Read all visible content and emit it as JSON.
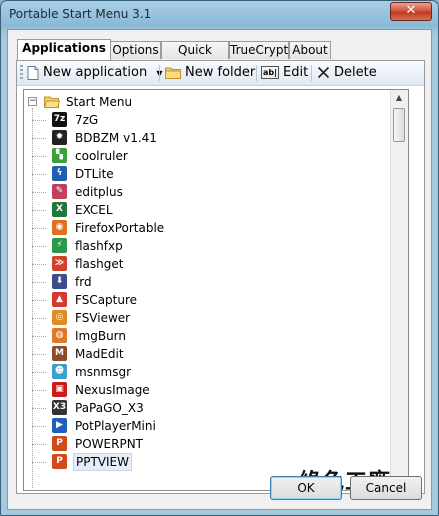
{
  "window": {
    "title": "Portable Start Menu 3.1",
    "close_glyph": "✕"
  },
  "tabs": [
    {
      "label": "Applications",
      "active": true
    },
    {
      "label": "Options",
      "active": false
    },
    {
      "label": "Quick Start",
      "active": false
    },
    {
      "label": "TrueCrypt",
      "active": false
    },
    {
      "label": "About",
      "active": false
    }
  ],
  "toolbar": {
    "new_application": "New application",
    "new_folder": "New folder",
    "edit": "Edit",
    "delete": "Delete",
    "edit_icon_text": "ab|"
  },
  "tree": {
    "root": "Start Menu",
    "items": [
      {
        "label": "7zG",
        "icon": "7z-icon",
        "color": "#111111",
        "glyph": "7z"
      },
      {
        "label": "BDBZM v1.41",
        "icon": "bdbzm-icon",
        "color": "#222222",
        "glyph": "✹"
      },
      {
        "label": "coolruler",
        "icon": "ruler-icon",
        "color": "#3aa03a",
        "glyph": "▚"
      },
      {
        "label": "DTLite",
        "icon": "daemon-tools-icon",
        "color": "#1f5fb0",
        "glyph": "ϟ"
      },
      {
        "label": "editplus",
        "icon": "editplus-icon",
        "color": "#c04060",
        "glyph": "✎"
      },
      {
        "label": "EXCEL",
        "icon": "excel-icon",
        "color": "#1f7a3a",
        "glyph": "X"
      },
      {
        "label": "FirefoxPortable",
        "icon": "firefox-icon",
        "color": "#e0701c",
        "glyph": "◉"
      },
      {
        "label": "flashfxp",
        "icon": "flashfxp-icon",
        "color": "#2a9a4a",
        "glyph": "⚡"
      },
      {
        "label": "flashget",
        "icon": "flashget-icon",
        "color": "#d0402a",
        "glyph": "≫"
      },
      {
        "label": "frd",
        "icon": "download-icon",
        "color": "#3b4d8a",
        "glyph": "⬇"
      },
      {
        "label": "FSCapture",
        "icon": "fscapture-icon",
        "color": "#d23a30",
        "glyph": "▲"
      },
      {
        "label": "FSViewer",
        "icon": "fsviewer-icon",
        "color": "#e08a20",
        "glyph": "◎"
      },
      {
        "label": "ImgBurn",
        "icon": "imgburn-icon",
        "color": "#e07a2a",
        "glyph": "◍"
      },
      {
        "label": "MadEdit",
        "icon": "madedit-icon",
        "color": "#8a4d2a",
        "glyph": "M"
      },
      {
        "label": "msnmsgr",
        "icon": "msn-icon",
        "color": "#3aa0d0",
        "glyph": "☻"
      },
      {
        "label": "NexusImage",
        "icon": "nexusimage-icon",
        "color": "#d01a1a",
        "glyph": "▣"
      },
      {
        "label": "PaPaGO_X3",
        "icon": "papago-icon",
        "color": "#333333",
        "glyph": "X3"
      },
      {
        "label": "PotPlayerMini",
        "icon": "potplayer-icon",
        "color": "#1e5fc0",
        "glyph": "▶"
      },
      {
        "label": "POWERPNT",
        "icon": "powerpoint-icon",
        "color": "#d04a1a",
        "glyph": "P"
      },
      {
        "label": "PPTVIEW",
        "icon": "pptview-icon",
        "color": "#d04a1a",
        "glyph": "P",
        "selected": true
      }
    ]
  },
  "watermark": "綠色工廠",
  "buttons": {
    "ok": "OK",
    "cancel": "Cancel"
  }
}
